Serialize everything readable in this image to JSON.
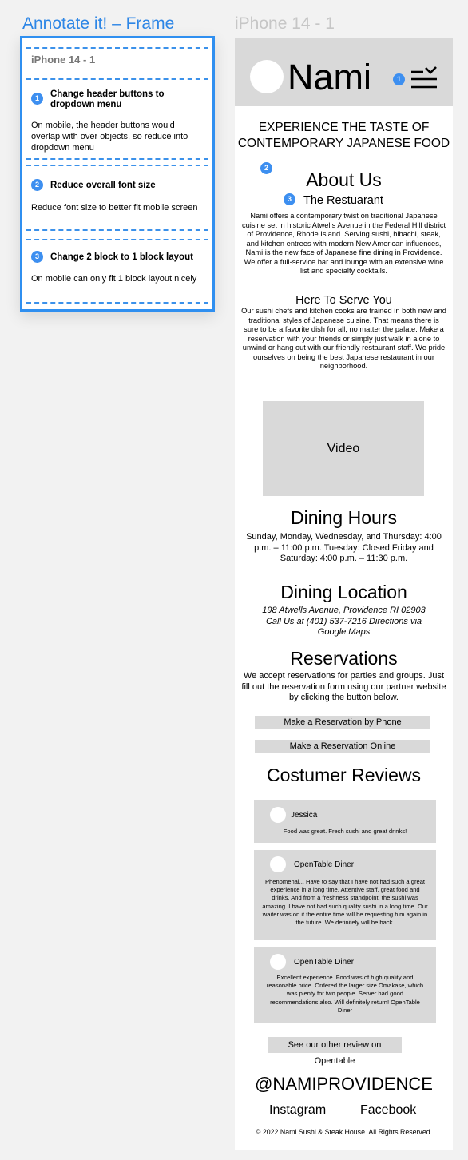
{
  "annotation_panel": {
    "title": "Annotate it! – Frame",
    "frame_name": "iPhone 14 - 1",
    "sections": [
      {
        "num": "1",
        "title": "Change header buttons to dropdown menu",
        "body": "On mobile, the header buttons would overlap with over objects, so reduce into dropdown menu"
      },
      {
        "num": "2",
        "title": "Reduce overall font size",
        "body": "Reduce font size to better fit mobile screen"
      },
      {
        "num": "3",
        "title": "Change 2 block to 1 block layout",
        "body": "On mobile can only fit 1 block layout nicely"
      }
    ]
  },
  "phone": {
    "label": "iPhone 14 - 1",
    "brand": "Nami",
    "markers": {
      "one": "1",
      "two": "2",
      "three": "3"
    },
    "hero": "EXPERIENCE THE TASTE OF CONTEMPORARY JAPANESE FOOD",
    "about": {
      "heading": "About Us",
      "subheading": "The Restuarant",
      "text": "Nami offers a contemporary twist on traditional Japanese cuisine set in historic Atwells Avenue in the Federal Hill district of Providence, Rhode Island. Serving sushi, hibachi, steak, and kitchen entrees with modern New American influences, Nami is the new face of Japanese fine dining in Providence. We offer a full-service bar and lounge with an extensive wine list and specialty cocktails."
    },
    "serve": {
      "heading": "Here To Serve You",
      "text": "Our sushi chefs and kitchen cooks are trained in both new and traditional styles of Japanese cuisine. That means there is sure to be a favorite dish for all, no matter the palate. Make a reservation with your friends or simply just walk in alone to unwind or hang out with our friendly restaurant staff. We pride ourselves on being the best Japanese restaurant in our neighborhood."
    },
    "video_label": "Video",
    "hours": {
      "heading": "Dining Hours",
      "text": "Sunday, Monday, Wednesday, and Thursday: 4:00 p.m. – 11:00 p.m. Tuesday: Closed Friday and Saturday: 4:00 p.m. – 11:30 p.m."
    },
    "location": {
      "heading": "Dining Location",
      "text": "198 Atwells Avenue, Providence RI 02903 Call Us at (401) 537-7216 Directions via Google Maps"
    },
    "reservations": {
      "heading": "Reservations",
      "text": "We accept reservations for parties and groups. Just fill out the reservation form using our partner website by clicking the button below.",
      "phone_button": "Make a Reservation by Phone",
      "online_button": "Make a Reservation Online"
    },
    "reviews": {
      "heading": "Costumer Reviews",
      "items": [
        {
          "name": "Jessica",
          "text": "Food was great. Fresh sushi and great drinks!"
        },
        {
          "name": "OpenTable Diner",
          "text": "Phenomenal... Have to say that I have not had such a great experience in a long time. Attentive staff, great food and drinks. And from a freshness standpoint, the sushi was amazing. I have not had such quality sushi in a long time. Our waiter was on it the entire time will be requesting him again in the future. We definitely will be back."
        },
        {
          "name": "OpenTable Diner",
          "text": "Excellent experience. Food was of high quality and reasonable price. Ordered the larger size Omakase, which was plenty for two people. Server had good recommendations also. Will definitely return! OpenTable Diner"
        }
      ],
      "more_button": "See our other review on Opentable"
    },
    "handle": "@NAMIPROVIDENCE",
    "social": {
      "instagram": "Instagram",
      "facebook": "Facebook"
    },
    "copyright": "© 2022 Nami Sushi & Steak House. All Rights Reserved."
  }
}
